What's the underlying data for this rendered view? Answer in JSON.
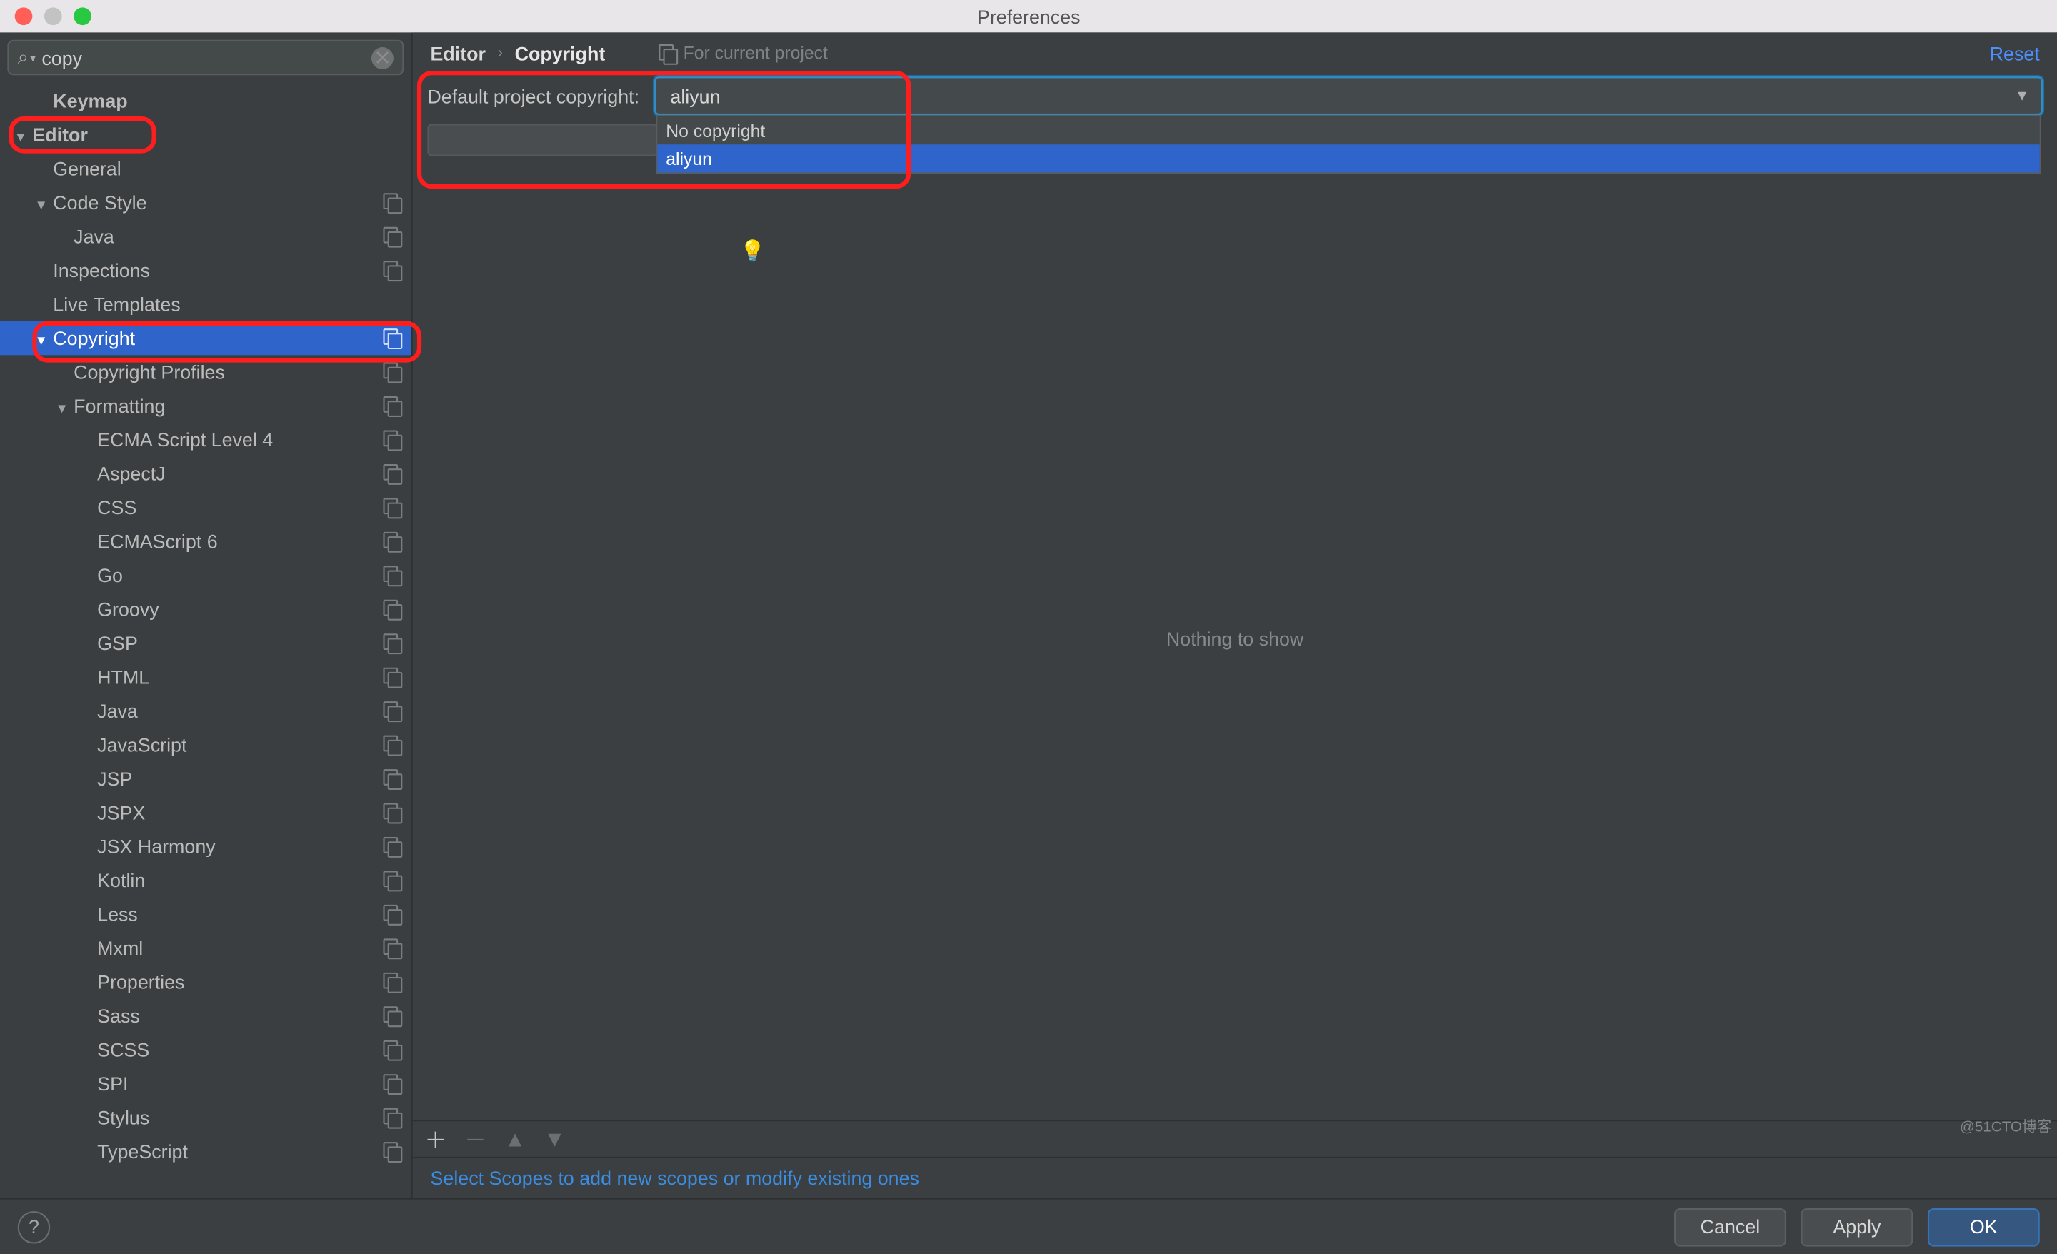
{
  "window": {
    "title": "Preferences"
  },
  "search": {
    "value": "copy"
  },
  "sidebar": {
    "items": [
      {
        "label": "Keymap",
        "indent": 1,
        "arrow": "",
        "bold": true,
        "proj": false,
        "selected": false
      },
      {
        "label": "Editor",
        "indent": 0,
        "arrow": "down",
        "bold": true,
        "proj": false,
        "selected": false
      },
      {
        "label": "General",
        "indent": 1,
        "arrow": "",
        "bold": false,
        "proj": false,
        "selected": false
      },
      {
        "label": "Code Style",
        "indent": 1,
        "arrow": "down",
        "bold": false,
        "proj": true,
        "selected": false
      },
      {
        "label": "Java",
        "indent": 2,
        "arrow": "",
        "bold": false,
        "proj": true,
        "selected": false
      },
      {
        "label": "Inspections",
        "indent": 1,
        "arrow": "",
        "bold": false,
        "proj": true,
        "selected": false
      },
      {
        "label": "Live Templates",
        "indent": 1,
        "arrow": "",
        "bold": false,
        "proj": false,
        "selected": false
      },
      {
        "label": "Copyright",
        "indent": 1,
        "arrow": "down",
        "bold": false,
        "proj": true,
        "selected": true
      },
      {
        "label": "Copyright Profiles",
        "indent": 2,
        "arrow": "",
        "bold": false,
        "proj": true,
        "selected": false
      },
      {
        "label": "Formatting",
        "indent": 2,
        "arrow": "down",
        "bold": false,
        "proj": true,
        "selected": false
      },
      {
        "label": "ECMA Script Level 4",
        "indent": 3,
        "arrow": "",
        "bold": false,
        "proj": true,
        "selected": false
      },
      {
        "label": "AspectJ",
        "indent": 3,
        "arrow": "",
        "bold": false,
        "proj": true,
        "selected": false
      },
      {
        "label": "CSS",
        "indent": 3,
        "arrow": "",
        "bold": false,
        "proj": true,
        "selected": false
      },
      {
        "label": "ECMAScript 6",
        "indent": 3,
        "arrow": "",
        "bold": false,
        "proj": true,
        "selected": false
      },
      {
        "label": "Go",
        "indent": 3,
        "arrow": "",
        "bold": false,
        "proj": true,
        "selected": false
      },
      {
        "label": "Groovy",
        "indent": 3,
        "arrow": "",
        "bold": false,
        "proj": true,
        "selected": false
      },
      {
        "label": "GSP",
        "indent": 3,
        "arrow": "",
        "bold": false,
        "proj": true,
        "selected": false
      },
      {
        "label": "HTML",
        "indent": 3,
        "arrow": "",
        "bold": false,
        "proj": true,
        "selected": false
      },
      {
        "label": "Java",
        "indent": 3,
        "arrow": "",
        "bold": false,
        "proj": true,
        "selected": false
      },
      {
        "label": "JavaScript",
        "indent": 3,
        "arrow": "",
        "bold": false,
        "proj": true,
        "selected": false
      },
      {
        "label": "JSP",
        "indent": 3,
        "arrow": "",
        "bold": false,
        "proj": true,
        "selected": false
      },
      {
        "label": "JSPX",
        "indent": 3,
        "arrow": "",
        "bold": false,
        "proj": true,
        "selected": false
      },
      {
        "label": "JSX Harmony",
        "indent": 3,
        "arrow": "",
        "bold": false,
        "proj": true,
        "selected": false
      },
      {
        "label": "Kotlin",
        "indent": 3,
        "arrow": "",
        "bold": false,
        "proj": true,
        "selected": false
      },
      {
        "label": "Less",
        "indent": 3,
        "arrow": "",
        "bold": false,
        "proj": true,
        "selected": false
      },
      {
        "label": "Mxml",
        "indent": 3,
        "arrow": "",
        "bold": false,
        "proj": true,
        "selected": false
      },
      {
        "label": "Properties",
        "indent": 3,
        "arrow": "",
        "bold": false,
        "proj": true,
        "selected": false
      },
      {
        "label": "Sass",
        "indent": 3,
        "arrow": "",
        "bold": false,
        "proj": true,
        "selected": false
      },
      {
        "label": "SCSS",
        "indent": 3,
        "arrow": "",
        "bold": false,
        "proj": true,
        "selected": false
      },
      {
        "label": "SPI",
        "indent": 3,
        "arrow": "",
        "bold": false,
        "proj": true,
        "selected": false
      },
      {
        "label": "Stylus",
        "indent": 3,
        "arrow": "",
        "bold": false,
        "proj": true,
        "selected": false
      },
      {
        "label": "TypeScript",
        "indent": 3,
        "arrow": "",
        "bold": false,
        "proj": true,
        "selected": false
      }
    ]
  },
  "breadcrumb": {
    "items": [
      "Editor",
      "Copyright"
    ],
    "project_note": "For current project",
    "reset": "Reset"
  },
  "form": {
    "default_copyright_label": "Default project copyright:",
    "default_copyright_value": "aliyun",
    "options": [
      {
        "label": "No copyright",
        "selected": false
      },
      {
        "label": "aliyun",
        "selected": true
      }
    ]
  },
  "center": {
    "empty_text": "Nothing to show"
  },
  "hint": "Select Scopes to add new scopes or modify existing ones",
  "footer": {
    "help": "?",
    "cancel": "Cancel",
    "apply": "Apply",
    "ok": "OK"
  },
  "watermark": "@51CTO博客"
}
